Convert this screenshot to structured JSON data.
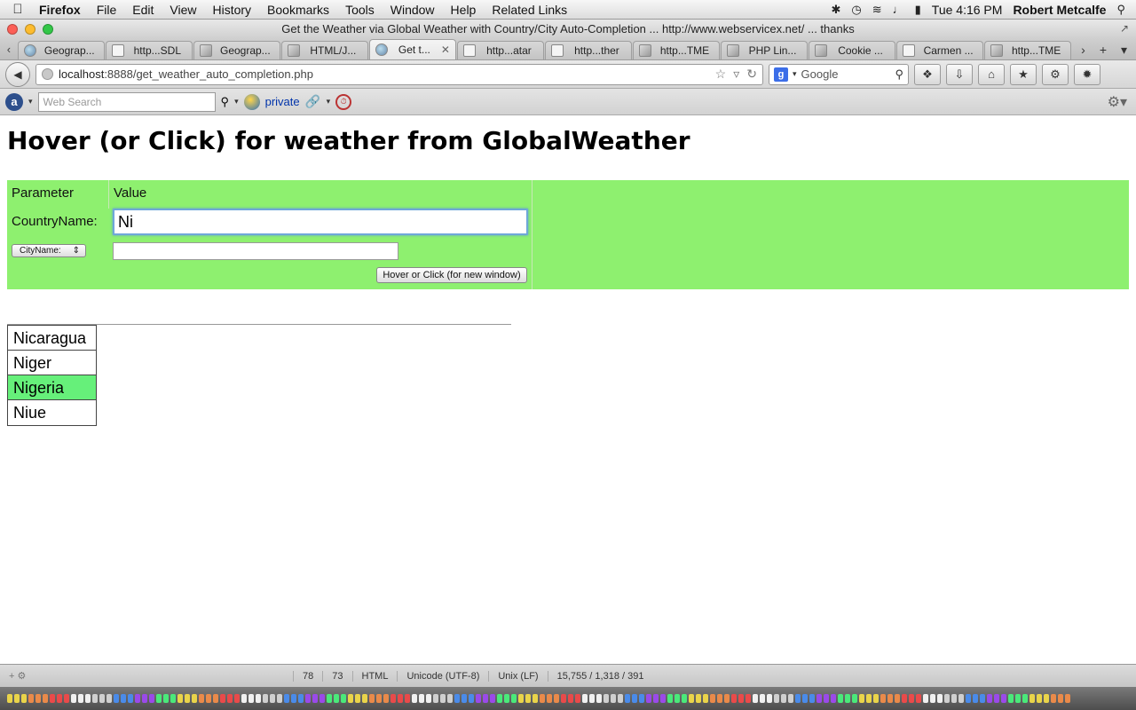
{
  "menubar": {
    "app": "Firefox",
    "items": [
      "File",
      "Edit",
      "View",
      "History",
      "Bookmarks",
      "Tools",
      "Window",
      "Help",
      "Related Links"
    ],
    "clock": "Tue 4:16 PM",
    "user": "Robert Metcalfe",
    "icons": [
      "bluetooth-icon",
      "time-machine-icon",
      "wifi-icon",
      "volume-icon",
      "battery-icon",
      "spotlight-icon"
    ]
  },
  "window": {
    "title": "Get the Weather via Global Weather with Country/City Auto-Completion ... http://www.webservicex.net/ ... thanks"
  },
  "tabs": [
    {
      "label": "Geograp...",
      "active": false
    },
    {
      "label": "http...SDL",
      "active": false
    },
    {
      "label": "Geograp...",
      "active": false
    },
    {
      "label": "HTML/J...",
      "active": false
    },
    {
      "label": "Get t...",
      "active": true
    },
    {
      "label": "http...atar",
      "active": false
    },
    {
      "label": "http...ther",
      "active": false
    },
    {
      "label": "http...TME",
      "active": false
    },
    {
      "label": "PHP Lin...",
      "active": false
    },
    {
      "label": "Cookie ...",
      "active": false
    },
    {
      "label": "Carmen ...",
      "active": false
    },
    {
      "label": "http...TME",
      "active": false
    }
  ],
  "navbar": {
    "url_host": "localhost",
    "url_path": ":8888/get_weather_auto_completion.php",
    "search_engine": "Google"
  },
  "addonbar": {
    "search_placeholder": "Web Search",
    "private_label": "private"
  },
  "page": {
    "heading": "Hover (or Click) for weather from GlobalWeather",
    "table": {
      "header_param": "Parameter",
      "header_value": "Value",
      "country_label": "CountryName:",
      "country_value": "Ni",
      "city_select": "CityName:",
      "city_value": "",
      "button_label": "Hover or Click (for new window)"
    },
    "suggestions": [
      {
        "label": "Nicaragua",
        "highlighted": false
      },
      {
        "label": "Niger",
        "highlighted": false
      },
      {
        "label": "Nigeria",
        "highlighted": true
      },
      {
        "label": "Niue",
        "highlighted": false
      }
    ]
  },
  "editor_status": {
    "line": "78",
    "col": "73",
    "syntax": "HTML",
    "encoding": "Unicode (UTF-8)",
    "line_endings": "Unix (LF)",
    "stats": "15,755 / 1,318 / 391"
  },
  "colors": {
    "form_bg": "#8ef06f",
    "highlight": "#66f07a",
    "focus_ring": "#6fa7d8"
  }
}
